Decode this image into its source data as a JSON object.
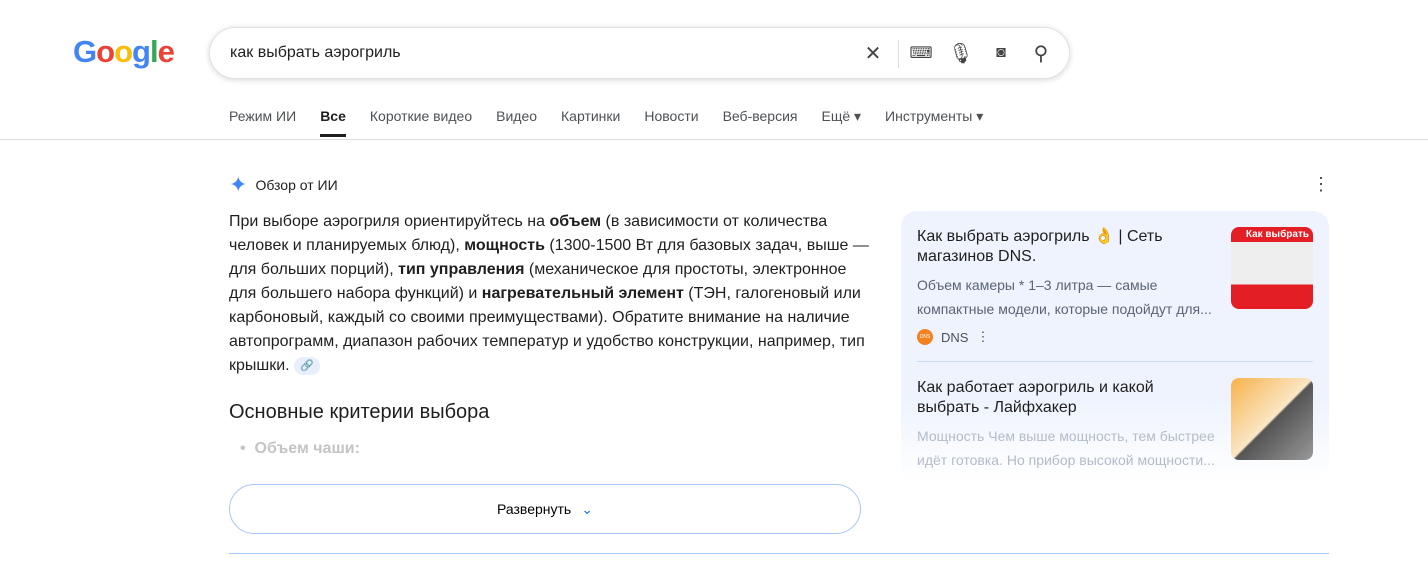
{
  "logo": "Google",
  "search": {
    "query": "как выбрать аэрогриль"
  },
  "tabs": [
    "Режим ИИ",
    "Все",
    "Короткие видео",
    "Видео",
    "Картинки",
    "Новости",
    "Веб-версия",
    "Ещё ▾",
    "Инструменты ▾"
  ],
  "ai": {
    "title": "Обзор от ИИ",
    "p": [
      "При выборе аэрогриля ориентируйтесь на ",
      "объем",
      " (в зависимости от количества человек и планируемых блюд), ",
      "мощность",
      " (1300-1500 Вт для базовых задач, выше — для больших порций), ",
      "тип управления",
      " (механическое для простоты, электронное для большего набора функций) и ",
      "нагревательный элемент",
      " (ТЭН, галогеновый или карбоновый, каждый со своими преимуществами). Обратите внимание на наличие автопрограмм, диапазон рабочих температур и удобство конструкции, например, тип крышки."
    ],
    "heading": "Основные критерии выбора",
    "bullet": "Объем чаши:",
    "expand": "Развернуть"
  },
  "sources": [
    {
      "title": "Как выбрать аэрогриль 👌 | Сеть магазинов DNS.",
      "snippet": "Объем камеры * 1–3 литра — самые компактные модели, которые подойдут для...",
      "site": "DNS",
      "thumb_text": "Как выбрать"
    },
    {
      "title": "Как работает аэрогриль и какой выбрать - Лайфхакер",
      "snippet": "Мощность Чем выше мощность, тем быстрее идёт готовка. Но прибор высокой мощности..."
    }
  ]
}
